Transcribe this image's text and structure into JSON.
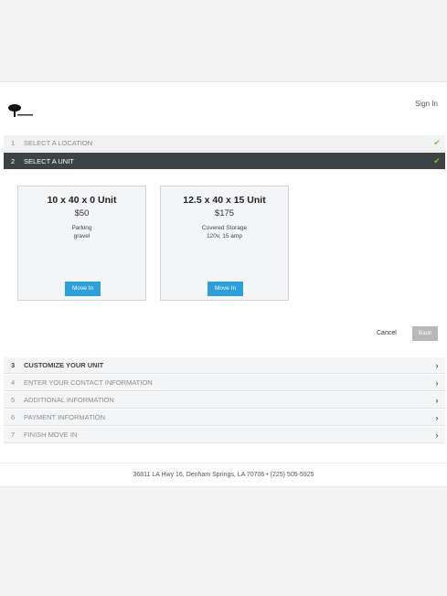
{
  "header": {
    "sign_in": "Sign In",
    "logo_icon": "tree-logo-icon"
  },
  "steps": [
    {
      "num": "1",
      "label": "SELECT A LOCATION",
      "state": "done",
      "icon": "check-icon"
    },
    {
      "num": "2",
      "label": "SELECT A UNIT",
      "state": "active",
      "icon": "check-icon"
    },
    {
      "num": "3",
      "label": "CUSTOMIZE YOUR UNIT",
      "state": "future",
      "icon": "chevron-right-icon"
    },
    {
      "num": "4",
      "label": "ENTER YOUR CONTACT INFORMATION",
      "state": "future",
      "icon": "chevron-right-icon"
    },
    {
      "num": "5",
      "label": "ADDITIONAL INFORMATION",
      "state": "future",
      "icon": "chevron-right-icon"
    },
    {
      "num": "6",
      "label": "PAYMENT INFORMATION",
      "state": "future",
      "icon": "chevron-right-icon"
    },
    {
      "num": "7",
      "label": "FINISH MOVE IN",
      "state": "future",
      "icon": "chevron-right-icon"
    }
  ],
  "units": [
    {
      "title": "10 x 40 x 0 Unit",
      "price": "$50",
      "desc1": "Parking",
      "desc2": "gravel",
      "button": "Move In"
    },
    {
      "title": "12.5 x 40 x 15 Unit",
      "price": "$175",
      "desc1": "Covered Storage",
      "desc2": "120v, 15 amp",
      "button": "Move In"
    }
  ],
  "actions": {
    "cancel": "Cancel",
    "back": "Back"
  },
  "footer": {
    "address": "36811 LA Hwy 16, Denham Springs, LA 70706 • (225) 505-5925"
  },
  "colors": {
    "active_step": "#3d4244",
    "check": "#8ab83c",
    "primary_button": "#2d9fd9",
    "disabled_button": "#b8b8b8"
  }
}
